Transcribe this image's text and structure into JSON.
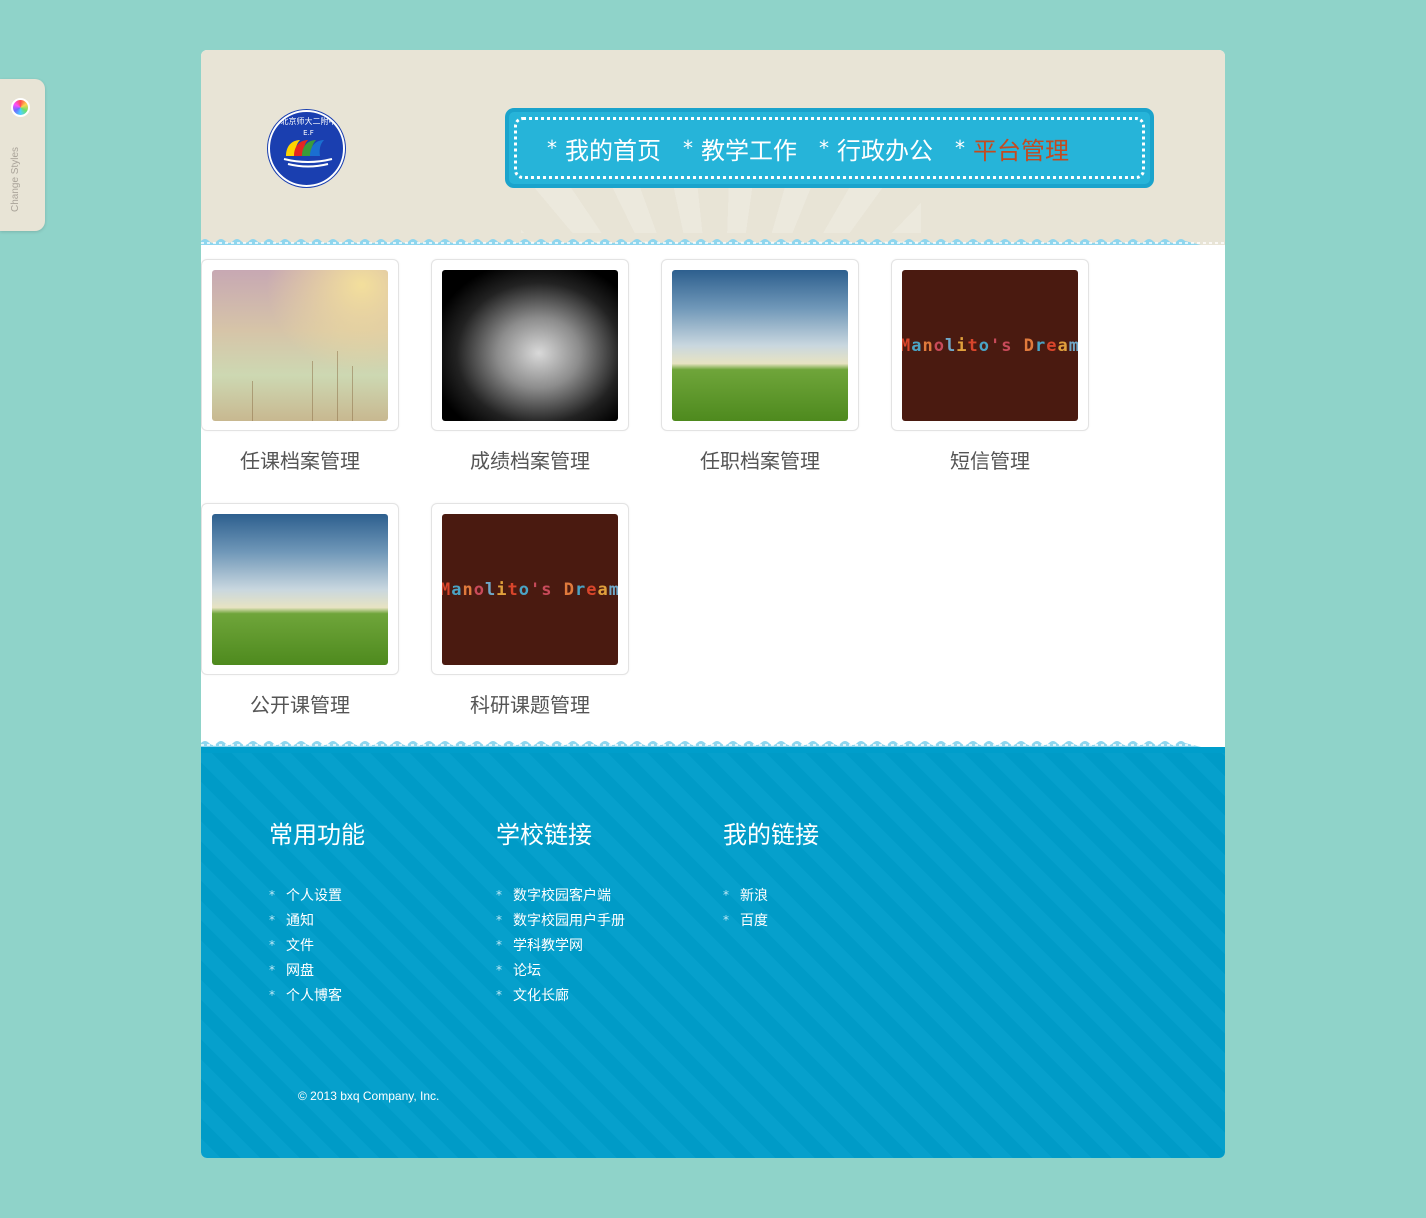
{
  "style_switcher": {
    "label": "Change Styles",
    "icon": "color-wheel-icon"
  },
  "logo": {
    "text": "北京师大二附中",
    "sub": "E.F"
  },
  "nav": {
    "items": [
      {
        "label": "我的首页",
        "active": false
      },
      {
        "label": "教学工作",
        "active": false
      },
      {
        "label": "行政办公",
        "active": false
      },
      {
        "label": "平台管理",
        "active": true
      }
    ],
    "bullet": "*"
  },
  "tiles": [
    {
      "label": "任课档案管理",
      "image": "meadow-flowers"
    },
    {
      "label": "成绩档案管理",
      "image": "child-portrait-bw"
    },
    {
      "label": "任职档案管理",
      "image": "green-hill-sky"
    },
    {
      "label": "短信管理",
      "image": "manolitos-dream",
      "image_text": "Manolito's Dream"
    },
    {
      "label": "公开课管理",
      "image": "green-hill-sky"
    },
    {
      "label": "科研课题管理",
      "image": "manolitos-dream",
      "image_text": "Manolito's Dream"
    }
  ],
  "footer": {
    "columns": [
      {
        "title": "常用功能",
        "items": [
          "个人设置",
          "通知",
          "文件",
          "网盘",
          "个人博客"
        ]
      },
      {
        "title": "学校链接",
        "items": [
          "数字校园客户端",
          "数字校园用户手册",
          "学科教学网",
          "论坛",
          "文化长廊"
        ]
      },
      {
        "title": "我的链接",
        "items": [
          "新浪",
          "百度"
        ]
      }
    ],
    "bullet": "*",
    "copyright": "© 2013 bxq Company, Inc."
  },
  "colors": {
    "page_bg": "#8fd3c9",
    "header_bg": "#e8e4d6",
    "nav_bg": "#26b4d9",
    "nav_active": "#c44a1f",
    "footer_bg": "#009ecb"
  }
}
